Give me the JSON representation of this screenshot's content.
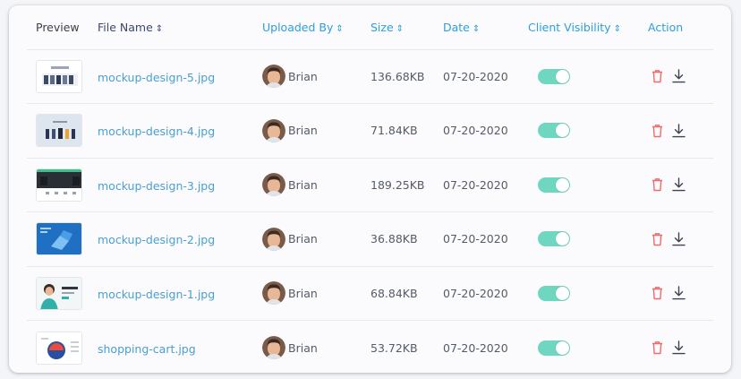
{
  "table": {
    "headers": {
      "preview": "Preview",
      "file_name": "File Name",
      "uploaded_by": "Uploaded By",
      "size": "Size",
      "date": "Date",
      "client_visibility": "Client Visibility",
      "action": "Action"
    },
    "sort_icon": "⇕",
    "rows": [
      {
        "file_name": "mockup-design-5.jpg",
        "uploaded_by": "Brian",
        "size": "136.68KB",
        "date": "07-20-2020",
        "client_visibility": true
      },
      {
        "file_name": "mockup-design-4.jpg",
        "uploaded_by": "Brian",
        "size": "71.84KB",
        "date": "07-20-2020",
        "client_visibility": true
      },
      {
        "file_name": "mockup-design-3.jpg",
        "uploaded_by": "Brian",
        "size": "189.25KB",
        "date": "07-20-2020",
        "client_visibility": true
      },
      {
        "file_name": "mockup-design-2.jpg",
        "uploaded_by": "Brian",
        "size": "36.88KB",
        "date": "07-20-2020",
        "client_visibility": true
      },
      {
        "file_name": "mockup-design-1.jpg",
        "uploaded_by": "Brian",
        "size": "68.84KB",
        "date": "07-20-2020",
        "client_visibility": true
      },
      {
        "file_name": "shopping-cart.jpg",
        "uploaded_by": "Brian",
        "size": "53.72KB",
        "date": "07-20-2020",
        "client_visibility": true
      }
    ]
  },
  "icons": {
    "sort": "sort-arrows-icon",
    "delete": "trash-icon",
    "download": "download-icon"
  },
  "colors": {
    "header_accent": "#2d9fd9",
    "file_link": "#4a9fd0",
    "toggle_on": "#6fd7c0",
    "delete_icon": "#ef6b6b",
    "download_icon": "#3d4350"
  }
}
